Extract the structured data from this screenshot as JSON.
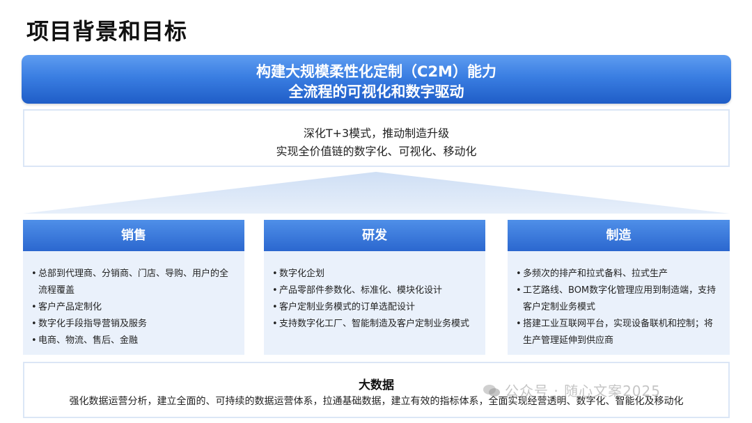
{
  "title": "项目背景和目标",
  "banner": {
    "line1": "构建大规模柔性化定制（C2M）能力",
    "line2": "全流程的可视化和数字驱动"
  },
  "vision": {
    "line1": "深化T+3模式，推动制造升级",
    "line2": "实现全价值链的数字化、可视化、移动化"
  },
  "pillars": [
    {
      "title": "销售",
      "items": [
        "总部到代理商、分销商、门店、导购、用户的全",
        "流程覆盖",
        "客户产品定制化",
        "数字化手段指导营销及服务",
        "电商、物流、售后、金融"
      ]
    },
    {
      "title": "研发",
      "items": [
        "数字化企划",
        "产品零部件参数化、标准化、模块化设计",
        "客户定制业务模式的订单选配设计",
        "支持数字化工厂、智能制造及客户定制业务模式"
      ]
    },
    {
      "title": "制造",
      "items": [
        "多频次的排产和拉式备料、拉式生产",
        "工艺路线、BOM数字化管理应用到制造端，支持",
        "客户定制业务模式",
        "搭建工业互联网平台，实现设备联机和控制；将",
        "生产管理延伸到供应商"
      ]
    }
  ],
  "bigdata": {
    "title": "大数据",
    "text": "强化数据运营分析，建立全面的、可持续的数据运营体系，拉通基础数据，建立有效的指标体系，全面实现经营透明、数字化、智能化及移动化"
  },
  "watermark": "公众号 · 随心文案2025",
  "colors": {
    "accent": "#2b67cf",
    "panel": "#eaf1fb"
  }
}
